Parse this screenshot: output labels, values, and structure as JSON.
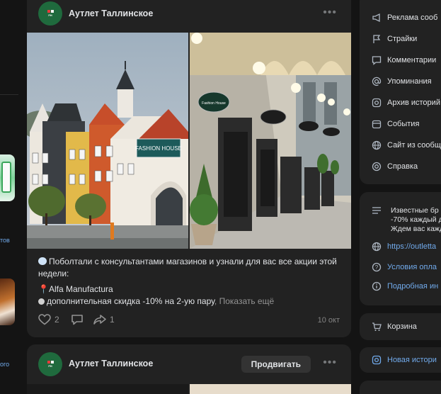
{
  "left_column": {
    "link_1": "тов",
    "link_2": "ого"
  },
  "post1": {
    "author": "Аутлет Таллинское",
    "more_label": "•••",
    "text_line_1": "Поболтали с консультантами магазинов и узнали для вас все акции этой",
    "text_line_2": "недели:",
    "store_line": "Alfa Manufactura",
    "discount_line": "дополнительная скидка -10% на 2-ую пару",
    "show_more": ", Показать ещё",
    "likes": "2",
    "shares": "1",
    "date": "10 окт",
    "sign_store": "FASHION HOUSE",
    "sign_shop": "Fashion House"
  },
  "post2": {
    "author": "Аутлет Таллинское",
    "promote_label": "Продвигать",
    "more_label": "•••"
  },
  "right_menu": {
    "items": [
      {
        "label": "Реклама сооб",
        "icon": "megaphone-icon"
      },
      {
        "label": "Страйки",
        "icon": "flag-icon"
      },
      {
        "label": "Комментарии",
        "icon": "comment-icon"
      },
      {
        "label": "Упоминания",
        "icon": "at-icon"
      },
      {
        "label": "Архив историй",
        "icon": "archive-icon"
      },
      {
        "label": "События",
        "icon": "calendar-icon"
      },
      {
        "label": "Сайт из сообщ",
        "icon": "globe-icon"
      },
      {
        "label": "Справка",
        "icon": "help-icon"
      }
    ]
  },
  "right_info": {
    "desc_1": "Известные бр",
    "desc_2": "-70% каждый д",
    "desc_3": "Ждем вас кажд",
    "link": "https://outletta",
    "payment": "Условия опла",
    "details": "Подробная ин"
  },
  "right_cart": {
    "label": "Корзина"
  },
  "right_story": {
    "label": "Новая истори"
  },
  "colors": {
    "link": "#71aaeb",
    "card": "#222222",
    "background": "#141414"
  }
}
